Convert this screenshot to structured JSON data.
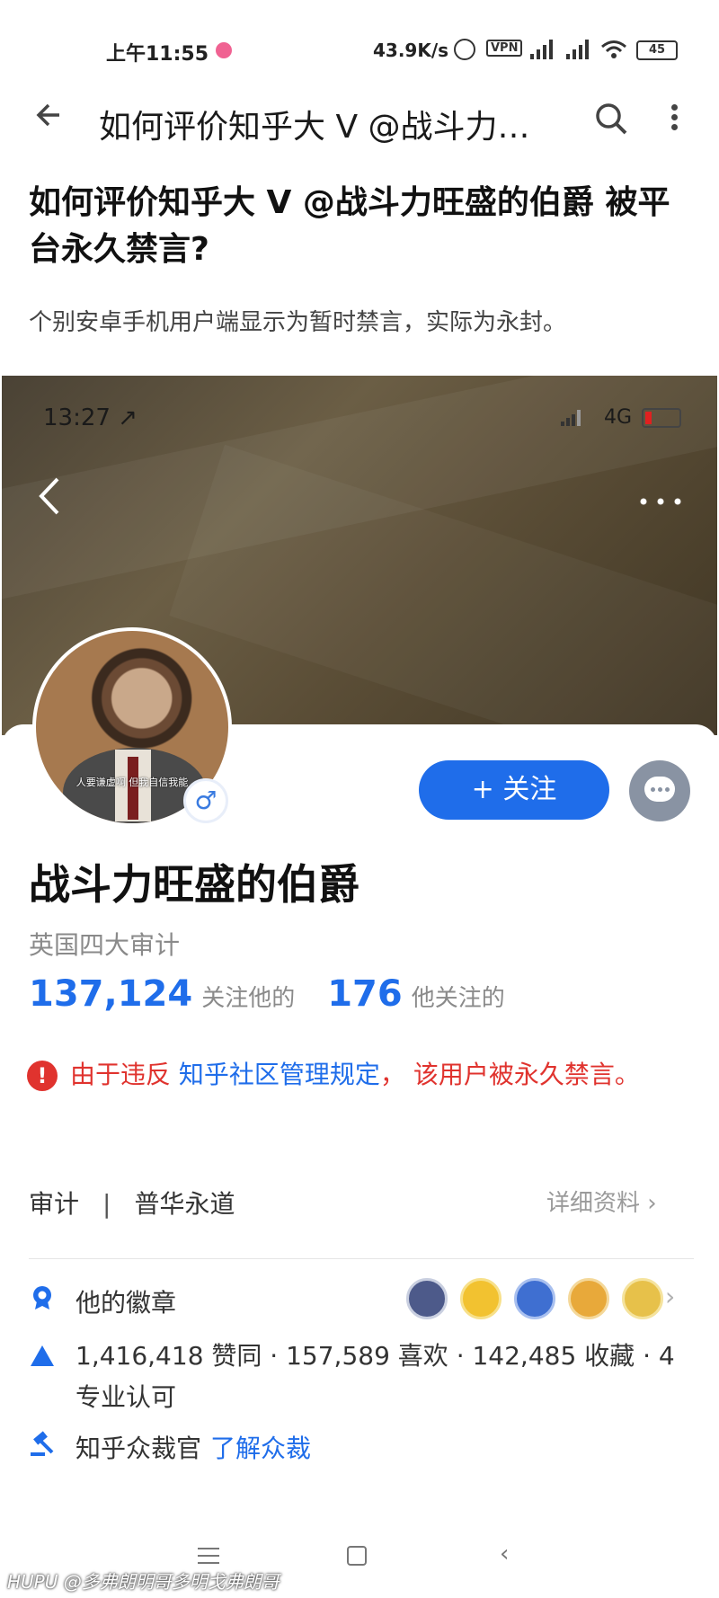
{
  "status_bar": {
    "time": "上午11:55",
    "net_speed": "43.9K/s",
    "vpn": "VPN",
    "battery": "45"
  },
  "app_bar": {
    "title": "如何评价知乎大 V @战斗力…"
  },
  "question": {
    "title": "如何评价知乎大 V @战斗力旺盛的伯爵 被平台永久禁言?",
    "description": "个别安卓手机用户端显示为暂时禁言，实际为永封。"
  },
  "screenshot": {
    "phone_status": {
      "time": "13:27 ↗",
      "network": "4G"
    },
    "profile": {
      "avatar_caption": "人要谦虚啊 但我自信我能",
      "gender_symbol": "♂",
      "follow_label": "+ 关注",
      "name": "战斗力旺盛的伯爵",
      "headline": "英国四大审计",
      "followers_count": "137,124",
      "followers_label": "关注他的",
      "following_count": "176",
      "following_label": "他关注的"
    },
    "ban_notice": {
      "icon": "!",
      "prefix": "由于违反 ",
      "link": "知乎社区管理规定",
      "suffix": "， 该用户被永久禁言。"
    },
    "info": {
      "industry": "审计",
      "separator": "|",
      "company": "普华永道",
      "detail_link": "详细资料 ›"
    },
    "badges": {
      "label": "他的徽章",
      "chevron": "›",
      "colors": [
        "#4d5a8a",
        "#f2c230",
        "#3f6fd1",
        "#e8a93a",
        "#e7c14a"
      ]
    },
    "achievements": {
      "text": "1,416,418 赞同 · 157,589 喜欢 · 142,485 收藏 · 4 专业认可"
    },
    "judge": {
      "label": "知乎众裁官",
      "link": "了解众裁"
    }
  },
  "nav_bar": {
    "back_glyph": "‹"
  },
  "watermark": "HUPU @多弗朗明哥多明戈弗朗哥",
  "colors": {
    "accent": "#1f6dea",
    "danger": "#e0332e",
    "muted": "#8a8a8a"
  }
}
